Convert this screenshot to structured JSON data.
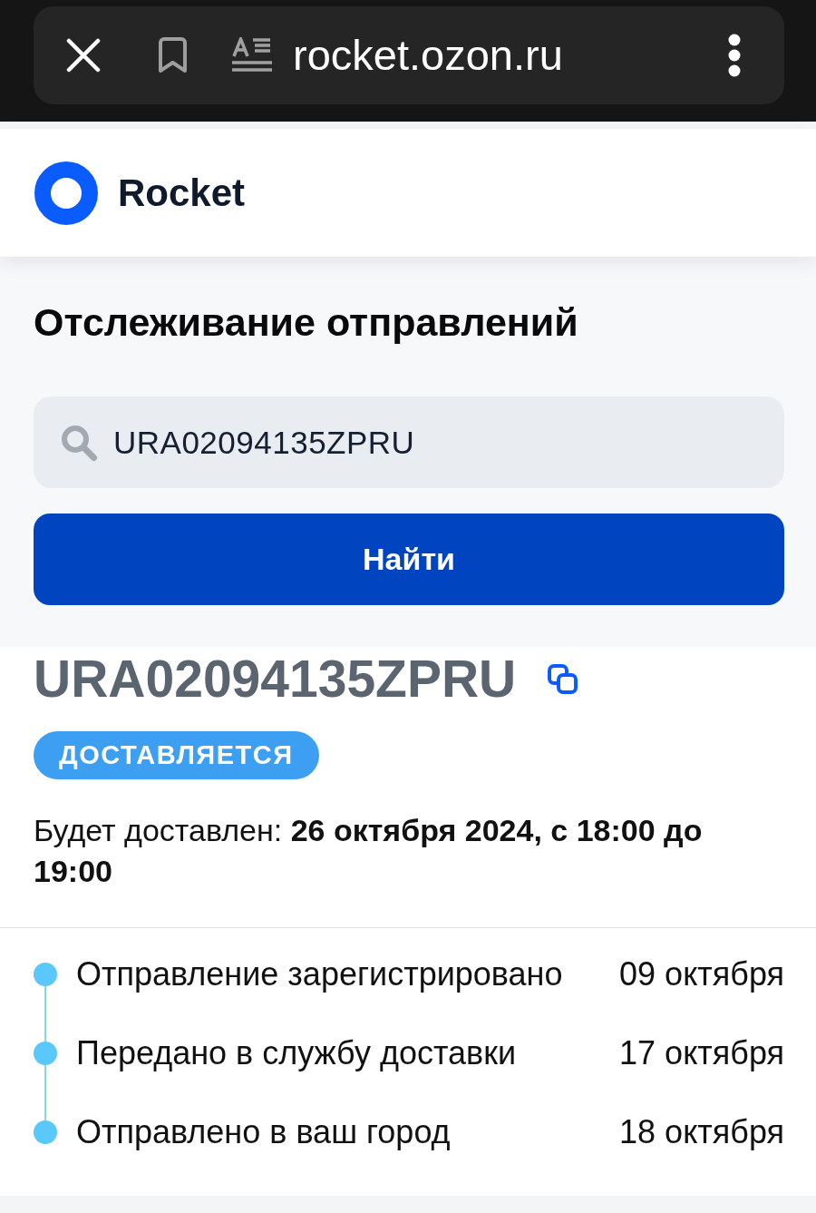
{
  "browser_bar": {
    "url": "rocket.ozon.ru"
  },
  "header": {
    "logo_text": "Rocket"
  },
  "tracking_form": {
    "title": "Отслеживание отправлений",
    "search_field": {
      "value": "URA02094135ZPRU"
    },
    "submit_button": "Найти"
  },
  "shipment": {
    "tracking_number": "URA02094135ZPRU",
    "status_badge": "ДОСТАВЛЯЕТСЯ",
    "delivery_info": "Будет доставлен: **26 октября 2024, с 18:00 до 19:00**"
  },
  "timeline": [
    {
      "event": "Отправление зарегистрировано",
      "date": "09 октября"
    },
    {
      "event": "Передано в службу доставки",
      "date": "17 октября"
    },
    {
      "event": "Отправлено в ваш город",
      "date": "18 октября"
    }
  ]
}
